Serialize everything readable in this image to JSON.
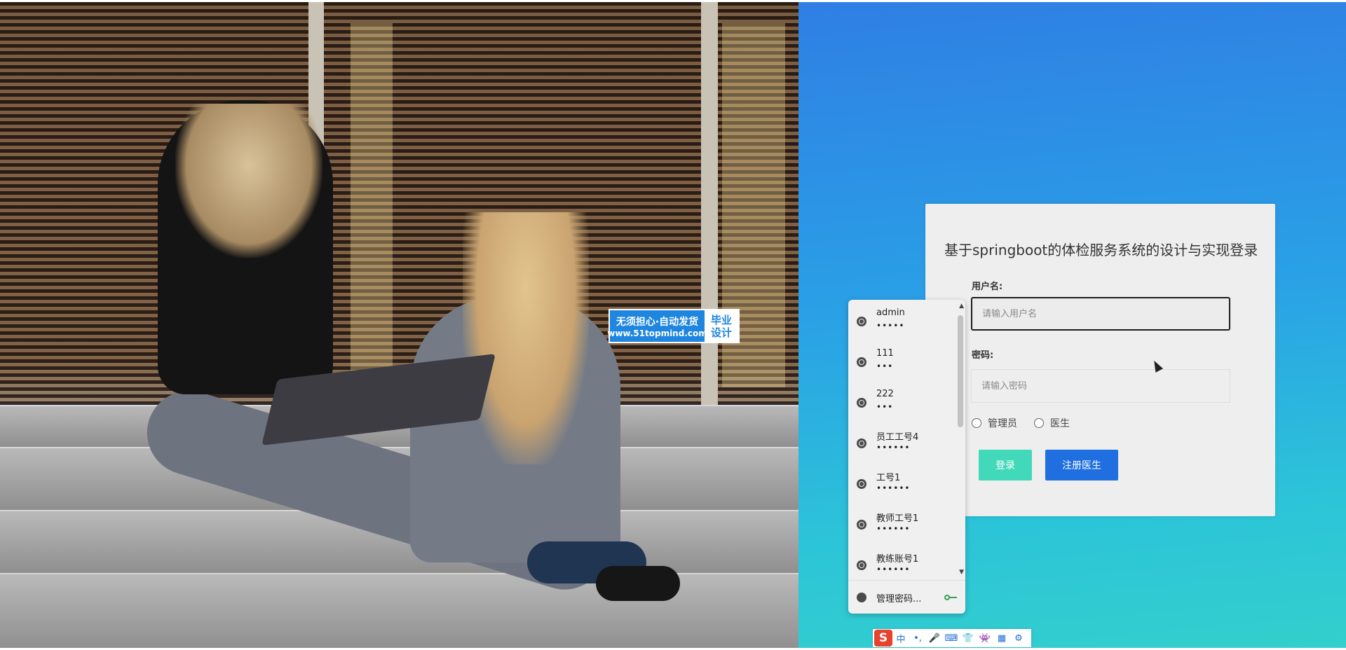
{
  "watermark": {
    "line1": "无须担心·自动发货",
    "line2": "www.51topmind.com",
    "tag_top": "毕业",
    "tag_bottom": "设计"
  },
  "login": {
    "title": "基于springboot的体检服务系统的设计与实现登录",
    "username_label": "用户名:",
    "username_placeholder": "请输入用户名",
    "password_label": "密码:",
    "password_placeholder": "请输入密码",
    "roles": [
      "管理员",
      "医生"
    ],
    "login_button": "登录",
    "register_button": "注册医生"
  },
  "saved_credentials": {
    "items": [
      {
        "username": "admin",
        "password_mask": "•••••"
      },
      {
        "username": "111",
        "password_mask": "•••"
      },
      {
        "username": "222",
        "password_mask": "•••"
      },
      {
        "username": "员工工号4",
        "password_mask": "••••••"
      },
      {
        "username": "工号1",
        "password_mask": "••••••"
      },
      {
        "username": "教师工号1",
        "password_mask": "••••••"
      },
      {
        "username": "教练账号1",
        "password_mask": "••••••"
      }
    ],
    "footer_label": "管理密码..."
  },
  "ime_toolbar": {
    "logo": "S",
    "items": [
      "中",
      "•,",
      "🎤",
      "⌨",
      "👕",
      "👾",
      "▦",
      "⚙"
    ]
  },
  "colors": {
    "login_button": "#41d9b9",
    "register_button": "#1f6fe0",
    "gradient_top": "#2f7fe4",
    "gradient_bottom": "#33cfcd"
  }
}
